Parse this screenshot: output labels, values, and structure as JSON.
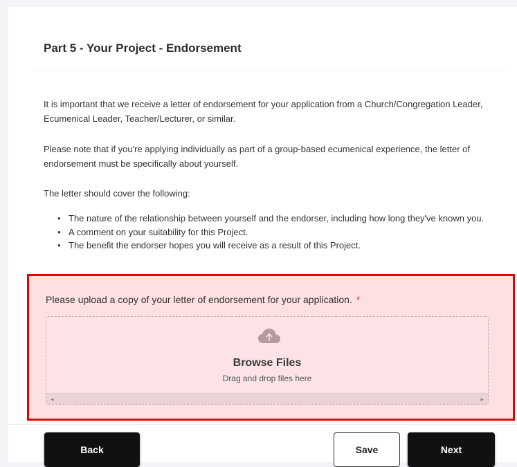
{
  "section": {
    "title": "Part 5 - Your Project - Endorsement"
  },
  "intro": {
    "paragraph1": "It is important that we receive a letter of endorsement for your application from a Church/Congregation Leader, Ecumenical Leader, Teacher/Lecturer, or similar.",
    "paragraph2": "Please note that if you're applying individually as part of a group-based ecumenical experience, the letter of endorsement must be specifically about yourself.",
    "paragraph3": "The letter should cover the following:",
    "bullets": [
      "The nature of the relationship between yourself and the endorser, including how long they've known you.",
      "A comment on your suitability for this Project.",
      "The benefit the endorser hopes you will receive as a result of this Project."
    ]
  },
  "upload": {
    "label": "Please upload a copy of your letter of endorsement for your application.",
    "required_marker": "*",
    "browse_label": "Browse Files",
    "drag_text": "Drag and drop files here",
    "icon": "cloud-upload-icon",
    "scroll_left": "◂",
    "scroll_right": "▸"
  },
  "footer": {
    "back_label": "Back",
    "save_label": "Save",
    "next_label": "Next"
  },
  "colors": {
    "highlight_border": "#e60000",
    "upload_bg": "#fde0e2",
    "primary_button": "#111111",
    "required": "#e0393e"
  }
}
